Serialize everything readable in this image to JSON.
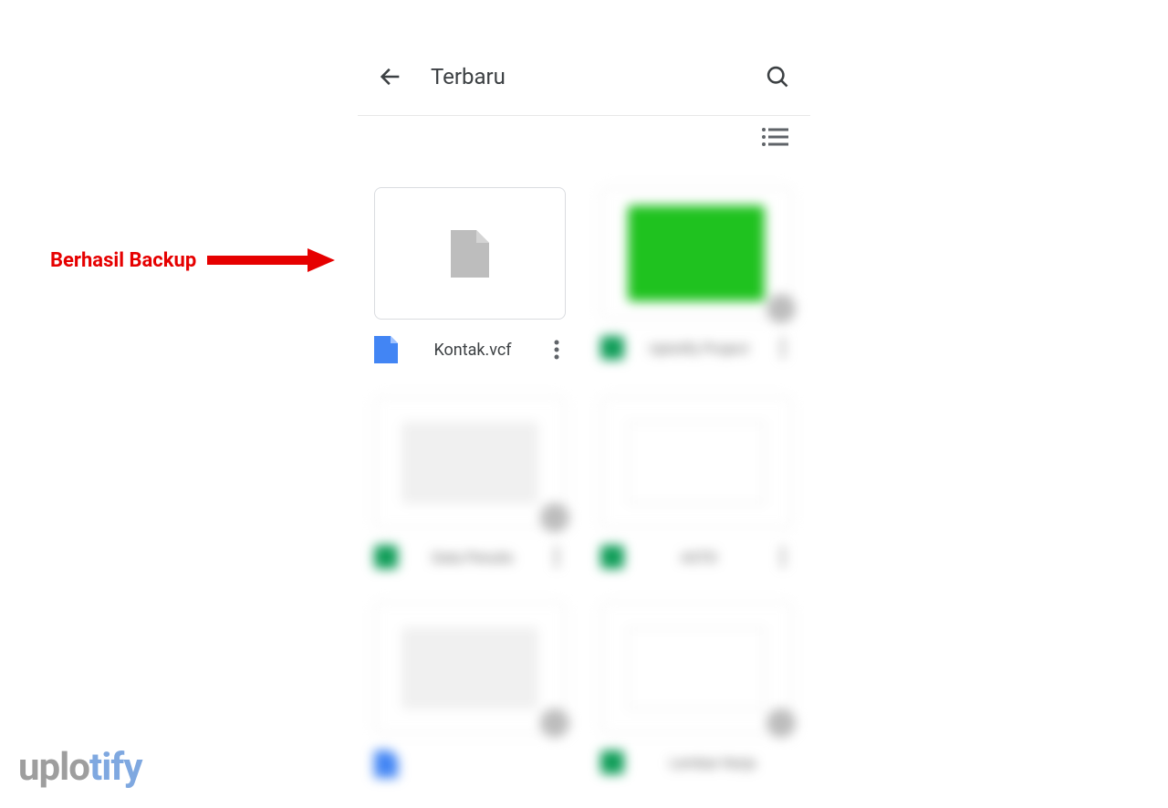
{
  "annotation": {
    "label": "Berhasil Backup"
  },
  "header": {
    "title": "Terbaru"
  },
  "files": [
    {
      "name": "Kontak.vcf"
    },
    {
      "name": "Uplotify Project"
    },
    {
      "name": "Data Penulis"
    },
    {
      "name": "ASTD"
    },
    {
      "name": ""
    },
    {
      "name": "Lembar Kerja"
    }
  ],
  "watermark": {
    "part1": "uplo",
    "part2": "tify"
  }
}
